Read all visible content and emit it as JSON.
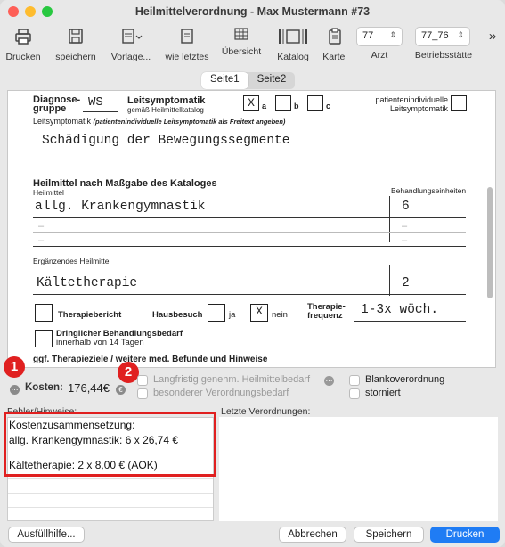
{
  "window": {
    "title": "Heilmittelverordnung -  Max Mustermann #73"
  },
  "toolbar": {
    "drucken": "Drucken",
    "speichern": "speichern",
    "vorlage": "Vorlage...",
    "wie_letztes": "wie letztes",
    "uebersicht": "Übersicht",
    "katalog": "Katalog",
    "kartei": "Kartei",
    "arzt_label": "Arzt",
    "arzt_value": "77",
    "betrieb_label": "Betriebsstätte",
    "betrieb_value": "77_76",
    "more": "»"
  },
  "tabs": [
    "Seite1",
    "Seite2"
  ],
  "form": {
    "diagnose_label_1": "Diagnose-",
    "diagnose_label_2": "gruppe",
    "diagnose_value": "WS",
    "leit_label": "Leitsymptomatik",
    "leit_sub": "gemäß Heilmittelkatalog",
    "leit_a_mark": "X",
    "leit_a": "a",
    "leit_b": "b",
    "leit_c": "c",
    "patient_label_1": "patientenindividuelle",
    "patient_label_2": "Leitsymptomatik",
    "leit_free_label_1": "Leitsymptomatik",
    "leit_free_label_2": "(patientenindividuelle Leitsymptomatik als Freitext angeben)",
    "leit_free_value": "Schädigung der Bewegungssegmente",
    "heilmittel_section": "Heilmittel nach Maßgabe des Kataloges",
    "heilmittel_label": "Heilmittel",
    "einheiten_label": "Behandlungseinheiten",
    "heilmittel_1": "allg. Krankengymnastik",
    "einheiten_1": "6",
    "dash": "–",
    "ergaenzend_label": "Ergänzendes Heilmittel",
    "ergaenzend_value": "Kältetherapie",
    "ergaenzend_einheiten": "2",
    "therapiebericht": "Therapiebericht",
    "hausbesuch": "Hausbesuch",
    "ja": "ja",
    "nein_mark": "X",
    "nein": "nein",
    "frequenz_label_1": "Therapie-",
    "frequenz_label_2": "frequenz",
    "frequenz_value": "1-3x wöch.",
    "dringlich_1": "Dringlicher Behandlungsbedarf",
    "dringlich_2": "innerhalb von 14 Tagen",
    "ziele": "ggf. Therapieziele / weitere med. Befunde und Hinweise"
  },
  "cost": {
    "badge_1": "1",
    "badge_2": "2",
    "label": "Kosten:",
    "value": "176,44€",
    "langfristig": "Langfristig genehm. Heilmittelbedarf",
    "besonderer": "besonderer Verordnungsbedarf",
    "blanko": "Blankoverordnung",
    "storniert": "storniert"
  },
  "lower": {
    "fehler_label": "Fehler/Hinweise:",
    "letzte_label": "Letzte Verordnungen:",
    "err_line_1": "Kostenzusammensetzung:",
    "err_line_2": "allg. Krankengymnastik: 6 x 26,74 €",
    "err_line_3": "Kältetherapie: 2 x 8,00 € (AOK)"
  },
  "buttons": {
    "ausfuellhilfe": "Ausfüllhilfe...",
    "abbrechen": "Abbrechen",
    "speichern": "Speichern",
    "drucken": "Drucken"
  },
  "colors": {
    "accent": "#1f7cf4",
    "highlight": "#e02020"
  }
}
